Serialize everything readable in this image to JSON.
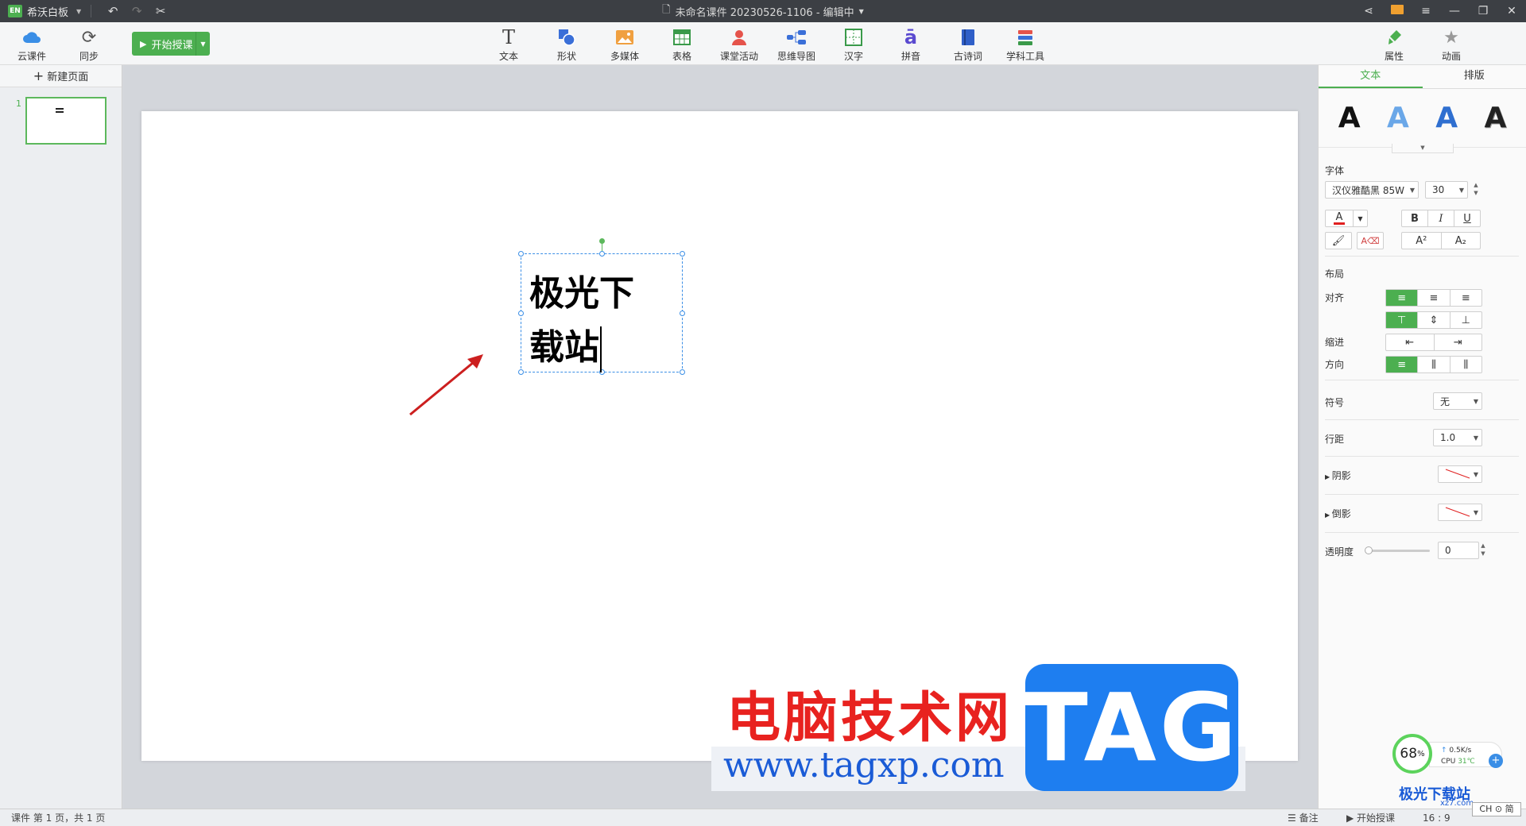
{
  "titlebar": {
    "app_badge": "EN",
    "app_name": "希沃白板",
    "doc_title": "未命名课件 20230526-1106 - 编辑中"
  },
  "toolbar": {
    "cloud_label": "云课件",
    "sync_label": "同步",
    "start_class_label": "开始授课",
    "tools": [
      {
        "label": "文本",
        "icon": "text-icon"
      },
      {
        "label": "形状",
        "icon": "shape-icon"
      },
      {
        "label": "多媒体",
        "icon": "media-icon"
      },
      {
        "label": "表格",
        "icon": "table-icon"
      },
      {
        "label": "课堂活动",
        "icon": "activity-icon"
      },
      {
        "label": "思维导图",
        "icon": "mindmap-icon"
      },
      {
        "label": "汉字",
        "icon": "hanzi-icon"
      },
      {
        "label": "拼音",
        "icon": "pinyin-icon"
      },
      {
        "label": "古诗词",
        "icon": "poetry-icon"
      },
      {
        "label": "学科工具",
        "icon": "subject-tools-icon"
      }
    ],
    "attr_label": "属性",
    "anim_label": "动画",
    "text_glyph": "T",
    "pinyin_glyph": "ā"
  },
  "left": {
    "new_page_label": "新建页面",
    "page_number": "1"
  },
  "canvas": {
    "textbox_line1": "极光下",
    "textbox_line2": "载站"
  },
  "watermark": {
    "cn": "电脑技术网",
    "url": "www.tagxp.com",
    "tag": "TAG",
    "logo": "极光下载站",
    "logo_sub": "xz7.com"
  },
  "right": {
    "tabs": [
      "文本",
      "排版"
    ],
    "style_letter": "A",
    "font_section": "字体",
    "font_name": "汉仪雅酷黑 85W",
    "font_size": "30",
    "bold": "B",
    "italic": "I",
    "underline": "U",
    "color_letter": "A",
    "superscript": "A²",
    "subscript": "A₂",
    "layout_section": "布局",
    "align_label": "对齐",
    "indent_label": "缩进",
    "direction_label": "方向",
    "symbol_label": "符号",
    "symbol_value": "无",
    "linespacing_label": "行距",
    "linespacing_value": "1.0",
    "shadow_label": "阴影",
    "reflection_label": "倒影",
    "opacity_label": "透明度",
    "opacity_value": "0"
  },
  "statusbar": {
    "page_info": "课件 第 1 页，共 1 页",
    "notes_label": "备注",
    "start_label": "开始授课",
    "ratio": "16 : 9"
  },
  "monitor": {
    "percent": "68",
    "percent_unit": "%",
    "speed": "0.5K/s",
    "cpu_label": "CPU",
    "cpu_temp": "31℃",
    "ime": "CH ⊙ 简"
  },
  "colors": {
    "accent": "#4caf50",
    "selection": "#3a8ee6",
    "titlebar": "#3c3f44"
  }
}
